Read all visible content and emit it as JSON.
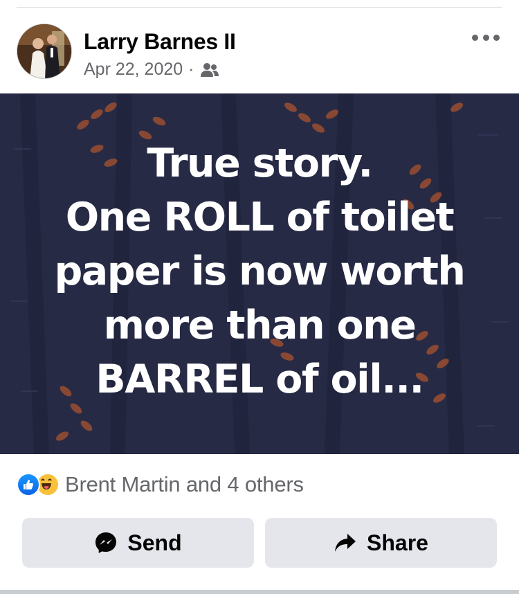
{
  "post": {
    "author": "Larry Barnes II",
    "date": "Apr 22, 2020",
    "separator": "·",
    "audience_icon": "friends-icon",
    "image_text": "True story.\nOne ROLL of toilet\npaper is now worth\nmore than one\nBARREL of oil..."
  },
  "reactions": {
    "icons": [
      "like-icon",
      "haha-icon"
    ],
    "summary": "Brent Martin and 4 others"
  },
  "actions": {
    "send_label": "Send",
    "share_label": "Share"
  },
  "colors": {
    "image_background": "#262a45",
    "leaf_accent": "#b4572b",
    "button_background": "#e4e6eb",
    "like_blue": "#1877f2",
    "secondary_text": "#65676b"
  }
}
